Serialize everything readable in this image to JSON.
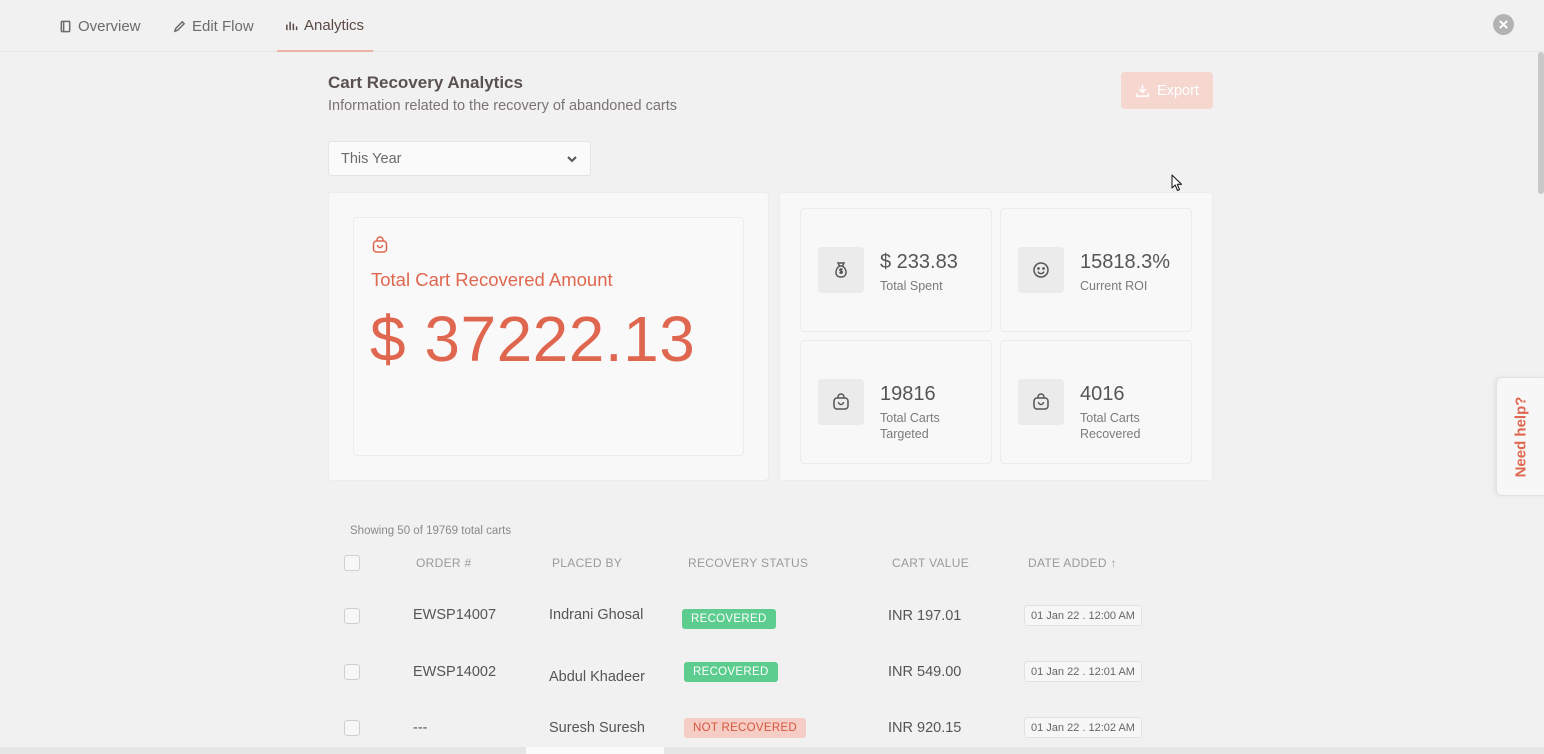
{
  "nav": {
    "tabs": [
      {
        "label": "Overview",
        "icon": "book-icon"
      },
      {
        "label": "Edit Flow",
        "icon": "pencil-icon"
      },
      {
        "label": "Analytics",
        "icon": "bar-chart-icon",
        "active": true
      }
    ]
  },
  "header": {
    "title": "Cart Recovery Analytics",
    "subtitle": "Information related to the recovery of abandoned carts",
    "export_label": "Export"
  },
  "filter": {
    "selected": "This Year"
  },
  "recovered": {
    "label": "Total Cart Recovered Amount",
    "value": "$ 37222.13"
  },
  "stats": [
    {
      "value": "$ 233.83",
      "label": "Total Spent",
      "icon": "money-bag-icon"
    },
    {
      "value": "15818.3%",
      "label": "Current ROI",
      "icon": "smiley-icon"
    },
    {
      "value": "19816",
      "label": "Total Carts Targeted",
      "icon": "shopping-bag-icon"
    },
    {
      "value": "4016",
      "label": "Total Carts Recovered",
      "icon": "shopping-bag-icon"
    }
  ],
  "table": {
    "count_text": "Showing 50 of 19769 total carts",
    "columns": [
      "ORDER #",
      "PLACED BY",
      "RECOVERY STATUS",
      "CART VALUE",
      "DATE ADDED ↑"
    ],
    "rows": [
      {
        "order": "EWSP14007",
        "placed_by": "Indrani Ghosal",
        "status": "RECOVERED",
        "value": "INR 197.01",
        "date": "01 Jan 22 . 12:00 AM"
      },
      {
        "order": "EWSP14002",
        "placed_by": "Abdul Khadeer",
        "status": "RECOVERED",
        "value": "INR 549.00",
        "date": "01 Jan 22 . 12:01 AM"
      },
      {
        "order": "---",
        "placed_by": "Suresh Suresh",
        "status": "NOT RECOVERED",
        "value": "INR 920.15",
        "date": "01 Jan 22 . 12:02 AM"
      }
    ]
  },
  "help": {
    "label": "Need help?"
  },
  "colors": {
    "accent": "#e0674f",
    "recovered_badge": "#5ccd8f",
    "not_recovered_badge": "#f6cdc5"
  }
}
